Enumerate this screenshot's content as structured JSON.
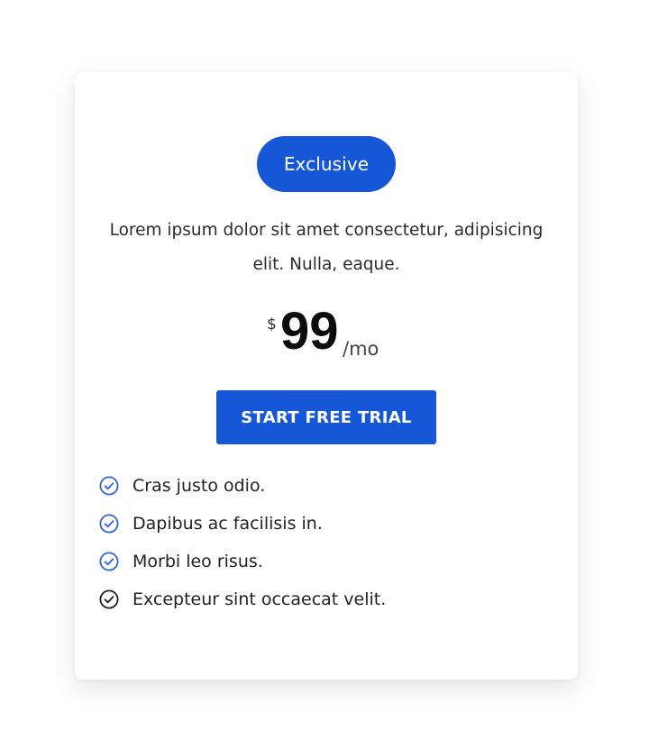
{
  "card": {
    "badge_label": "Exclusive",
    "description": "Lorem ipsum dolor sit amet consectetur, adipisicing elit. Nulla, eaque.",
    "price": {
      "currency": "$",
      "amount": "99",
      "period": "/mo"
    },
    "cta_label": "START FREE TRIAL",
    "features": [
      {
        "label": "Cras justo odio.",
        "icon": "check-circle-icon",
        "color": "#2f64d9"
      },
      {
        "label": "Dapibus ac facilisis in.",
        "icon": "check-circle-icon",
        "color": "#2f64d9"
      },
      {
        "label": "Morbi leo risus.",
        "icon": "check-circle-icon",
        "color": "#2f64d9"
      },
      {
        "label": "Excepteur sint occaecat velit.",
        "icon": "check-circle-icon",
        "color": "#1b1b1b"
      }
    ]
  },
  "colors": {
    "accent": "#1557d6",
    "text": "#222222",
    "background": "#ffffff"
  }
}
